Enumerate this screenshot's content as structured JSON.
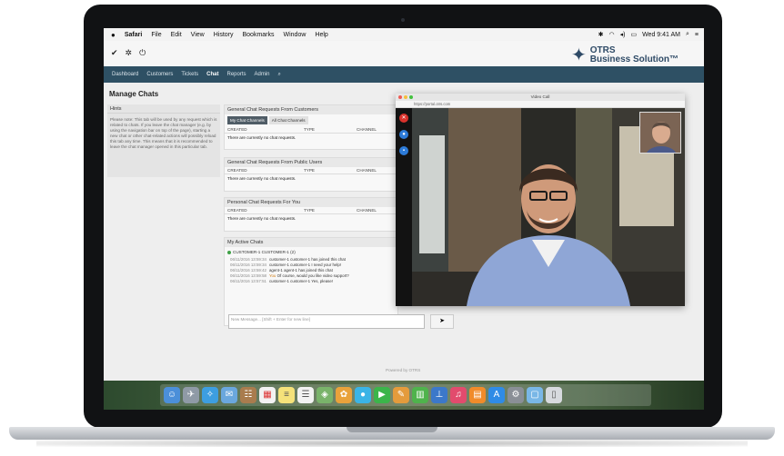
{
  "menubar": {
    "apple": "",
    "app": "Safari",
    "items": [
      "File",
      "Edit",
      "View",
      "History",
      "Bookmarks",
      "Window",
      "Help"
    ],
    "clock": "Wed 9:41 AM"
  },
  "logo": {
    "line1": "OTRS",
    "line2": "Business Solution™"
  },
  "nav": {
    "items": [
      "Dashboard",
      "Customers",
      "Tickets",
      "Chat",
      "Reports",
      "Admin"
    ],
    "active": "Chat"
  },
  "page": {
    "title": "Manage Chats"
  },
  "hints": {
    "title": "Hints",
    "text": "Please note: This tab will be used by any request which is related to chats. If you leave the chat manager (e.g. by using the navigation bar on top of the page), starting a new chat or other chat-related actions will possibly reload this tab any time. This means that it is recommended to leave the chat manager opened in this particular tab."
  },
  "sections": {
    "general_customers": {
      "title": "General Chat Requests From Customers",
      "tab_mine": "My Chat Channels",
      "tab_all": "All Chat Channels",
      "col_created": "CREATED",
      "col_type": "TYPE",
      "col_channel": "CHANNEL",
      "empty": "There are currently no chat requests."
    },
    "general_public": {
      "title": "General Chat Requests From Public Users",
      "col_created": "CREATED",
      "col_type": "TYPE",
      "col_channel": "CHANNEL",
      "empty": "There are currently no chat requests."
    },
    "personal": {
      "title": "Personal Chat Requests For You",
      "col_created": "CREATED",
      "col_type": "TYPE",
      "col_channel": "CHANNEL",
      "empty": "There are currently no chat requests."
    },
    "active": {
      "title": "My Active Chats",
      "chat_tab": "CUSTOMER-1 CUSTOMER-1 (2)",
      "messages": [
        {
          "ts": "06/11/2016 13:59:34",
          "who": "customer-1 customer-1",
          "text": "has joined this chat",
          "you": false
        },
        {
          "ts": "06/11/2016 13:59:34",
          "who": "customer-1 customer-1",
          "text": "I need your help!",
          "you": false
        },
        {
          "ts": "06/11/2016 13:59:42",
          "who": "agent-1 agent-1",
          "text": "has joined this chat",
          "you": false
        },
        {
          "ts": "06/11/2016 13:59:58",
          "who": "You",
          "text": "Of course, would you like video support?",
          "you": true
        },
        {
          "ts": "06/11/2016 13:57:51",
          "who": "customer-1 customer-1",
          "text": "Yes, please!",
          "you": false
        }
      ],
      "input_placeholder": "New Message... [Shift + Enter for new line]"
    }
  },
  "footer": "Powered by OTRS",
  "video_call": {
    "title": "Video Call",
    "url": "https://portal.otrs.com"
  },
  "colors": {
    "nav": "#2e5064",
    "accent": "#d0801d",
    "online": "#3fa147",
    "end_call": "#d9322c",
    "mic": "#2d7bd8"
  },
  "dock": [
    "finder",
    "launchpad",
    "safari",
    "mail",
    "contacts",
    "calendar",
    "notes",
    "reminders",
    "maps",
    "photos",
    "messages",
    "facetime",
    "pages",
    "numbers",
    "keynote",
    "itunes",
    "ibooks",
    "app-store",
    "system-preferences",
    "downloads",
    "trash"
  ]
}
